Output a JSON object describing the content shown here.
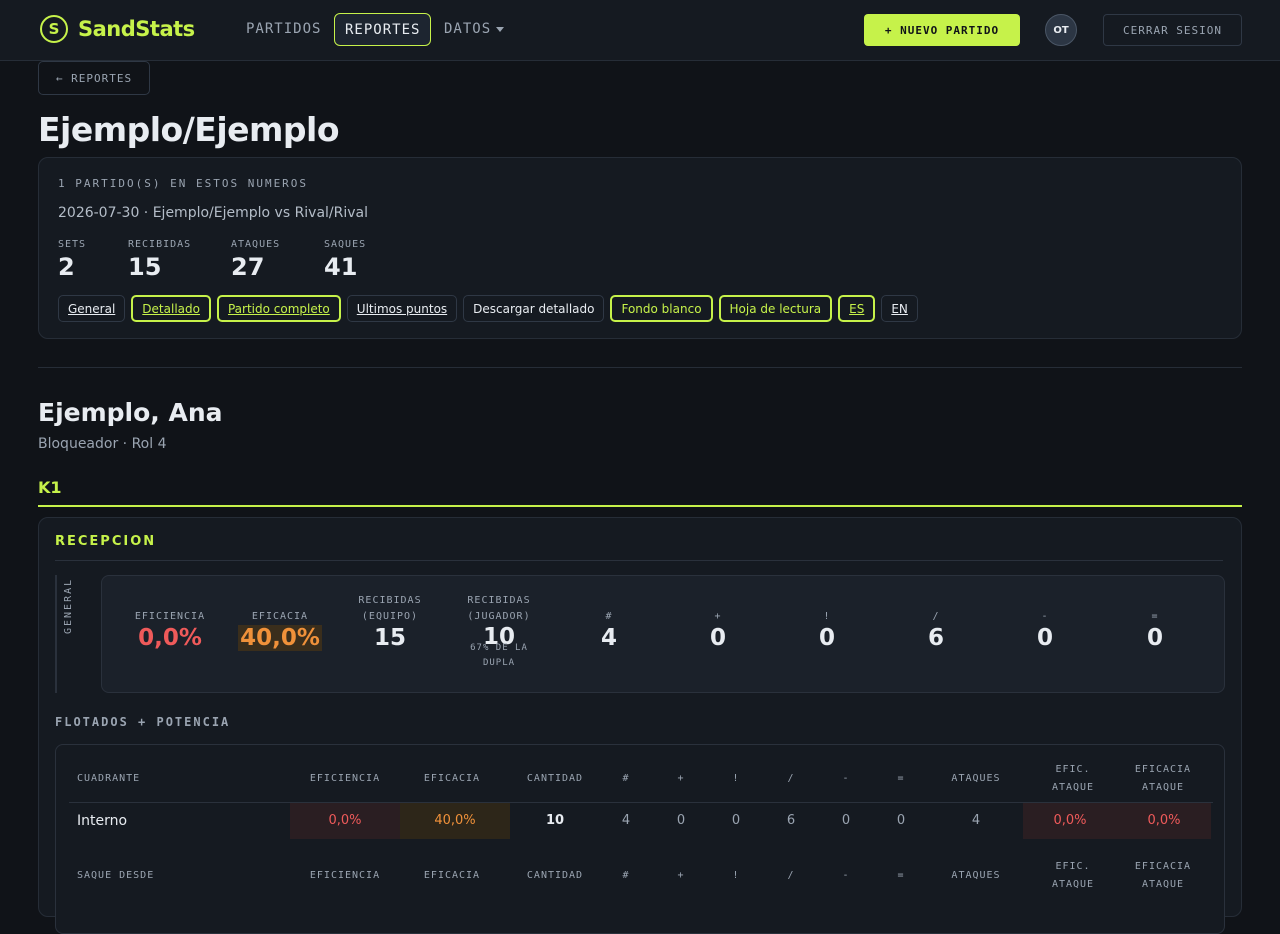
{
  "nav": {
    "logo_letter": "S",
    "logo": "SandStats",
    "links": [
      "PARTIDOS",
      "REPORTES",
      "DATOS"
    ],
    "new_match": "+ NUEVO PARTIDO",
    "avatar": "OT",
    "logout": "CERRAR SESION"
  },
  "back": "← REPORTES",
  "title": "Ejemplo/Ejemplo",
  "summary": {
    "caption": "1 PARTIDO(S) EN ESTOS NUMEROS",
    "match": "2026-07-30 · Ejemplo/Ejemplo vs Rival/Rival",
    "stats": [
      {
        "label": "SETS",
        "value": "2"
      },
      {
        "label": "RECIBIDAS",
        "value": "15"
      },
      {
        "label": "ATAQUES",
        "value": "27"
      },
      {
        "label": "SAQUES",
        "value": "41"
      }
    ],
    "chips": [
      "General",
      "Detallado",
      "Partido completo",
      "Ultimos puntos",
      "Descargar detallado",
      "Fondo blanco",
      "Hoja de lectura",
      "ES",
      "EN"
    ]
  },
  "player": {
    "name": "Ejemplo, Ana",
    "role": "Bloqueador · Rol 4",
    "group": "K1"
  },
  "reception": {
    "title": "RECEPCION",
    "general_label": "GENERAL",
    "metrics": {
      "eficiencia": {
        "label": "EFICIENCIA",
        "value": "0,0%"
      },
      "eficacia": {
        "label": "EFICACIA",
        "value": "40,0%"
      },
      "rec_equipo": {
        "label1": "RECIBIDAS",
        "label2": "(EQUIPO)",
        "value": "15"
      },
      "rec_jugador": {
        "label1": "RECIBIDAS",
        "label2": "(JUGADOR)",
        "value": "10",
        "sub1": "67% DE LA",
        "sub2": "DUPLA"
      },
      "symbols": [
        {
          "label": "#",
          "value": "4"
        },
        {
          "label": "+",
          "value": "0"
        },
        {
          "label": "!",
          "value": "0"
        },
        {
          "label": "/",
          "value": "6"
        },
        {
          "label": "-",
          "value": "0"
        },
        {
          "label": "=",
          "value": "0"
        }
      ]
    },
    "subsection": "FLOTADOS + POTENCIA",
    "table": {
      "headers": {
        "first": "CUADRANTE",
        "eficiencia": "EFICIENCIA",
        "eficacia": "EFICACIA",
        "cantidad": "CANTIDAD",
        "hash": "#",
        "plus": "+",
        "excl": "!",
        "slash": "/",
        "minus": "-",
        "eq": "=",
        "ataques": "ATAQUES",
        "efic_ataque_1": "EFIC.",
        "efic_ataque_2": "ATAQUE",
        "eficacia_ataque_1": "EFICACIA",
        "eficacia_ataque_2": "ATAQUE"
      },
      "row": {
        "name": "Interno",
        "eficiencia": "0,0%",
        "eficacia": "40,0%",
        "cantidad": "10",
        "hash": "4",
        "plus": "0",
        "excl": "0",
        "slash": "6",
        "minus": "0",
        "eq": "0",
        "ataques": "4",
        "efic_ataque": "0,0%",
        "eficacia_ataque": "0,0%"
      },
      "second_header_first": "SAQUE DESDE"
    }
  },
  "colors": {
    "accent": "#c6f24a",
    "bad": "#ef5a5a",
    "mid": "#f0913a"
  }
}
